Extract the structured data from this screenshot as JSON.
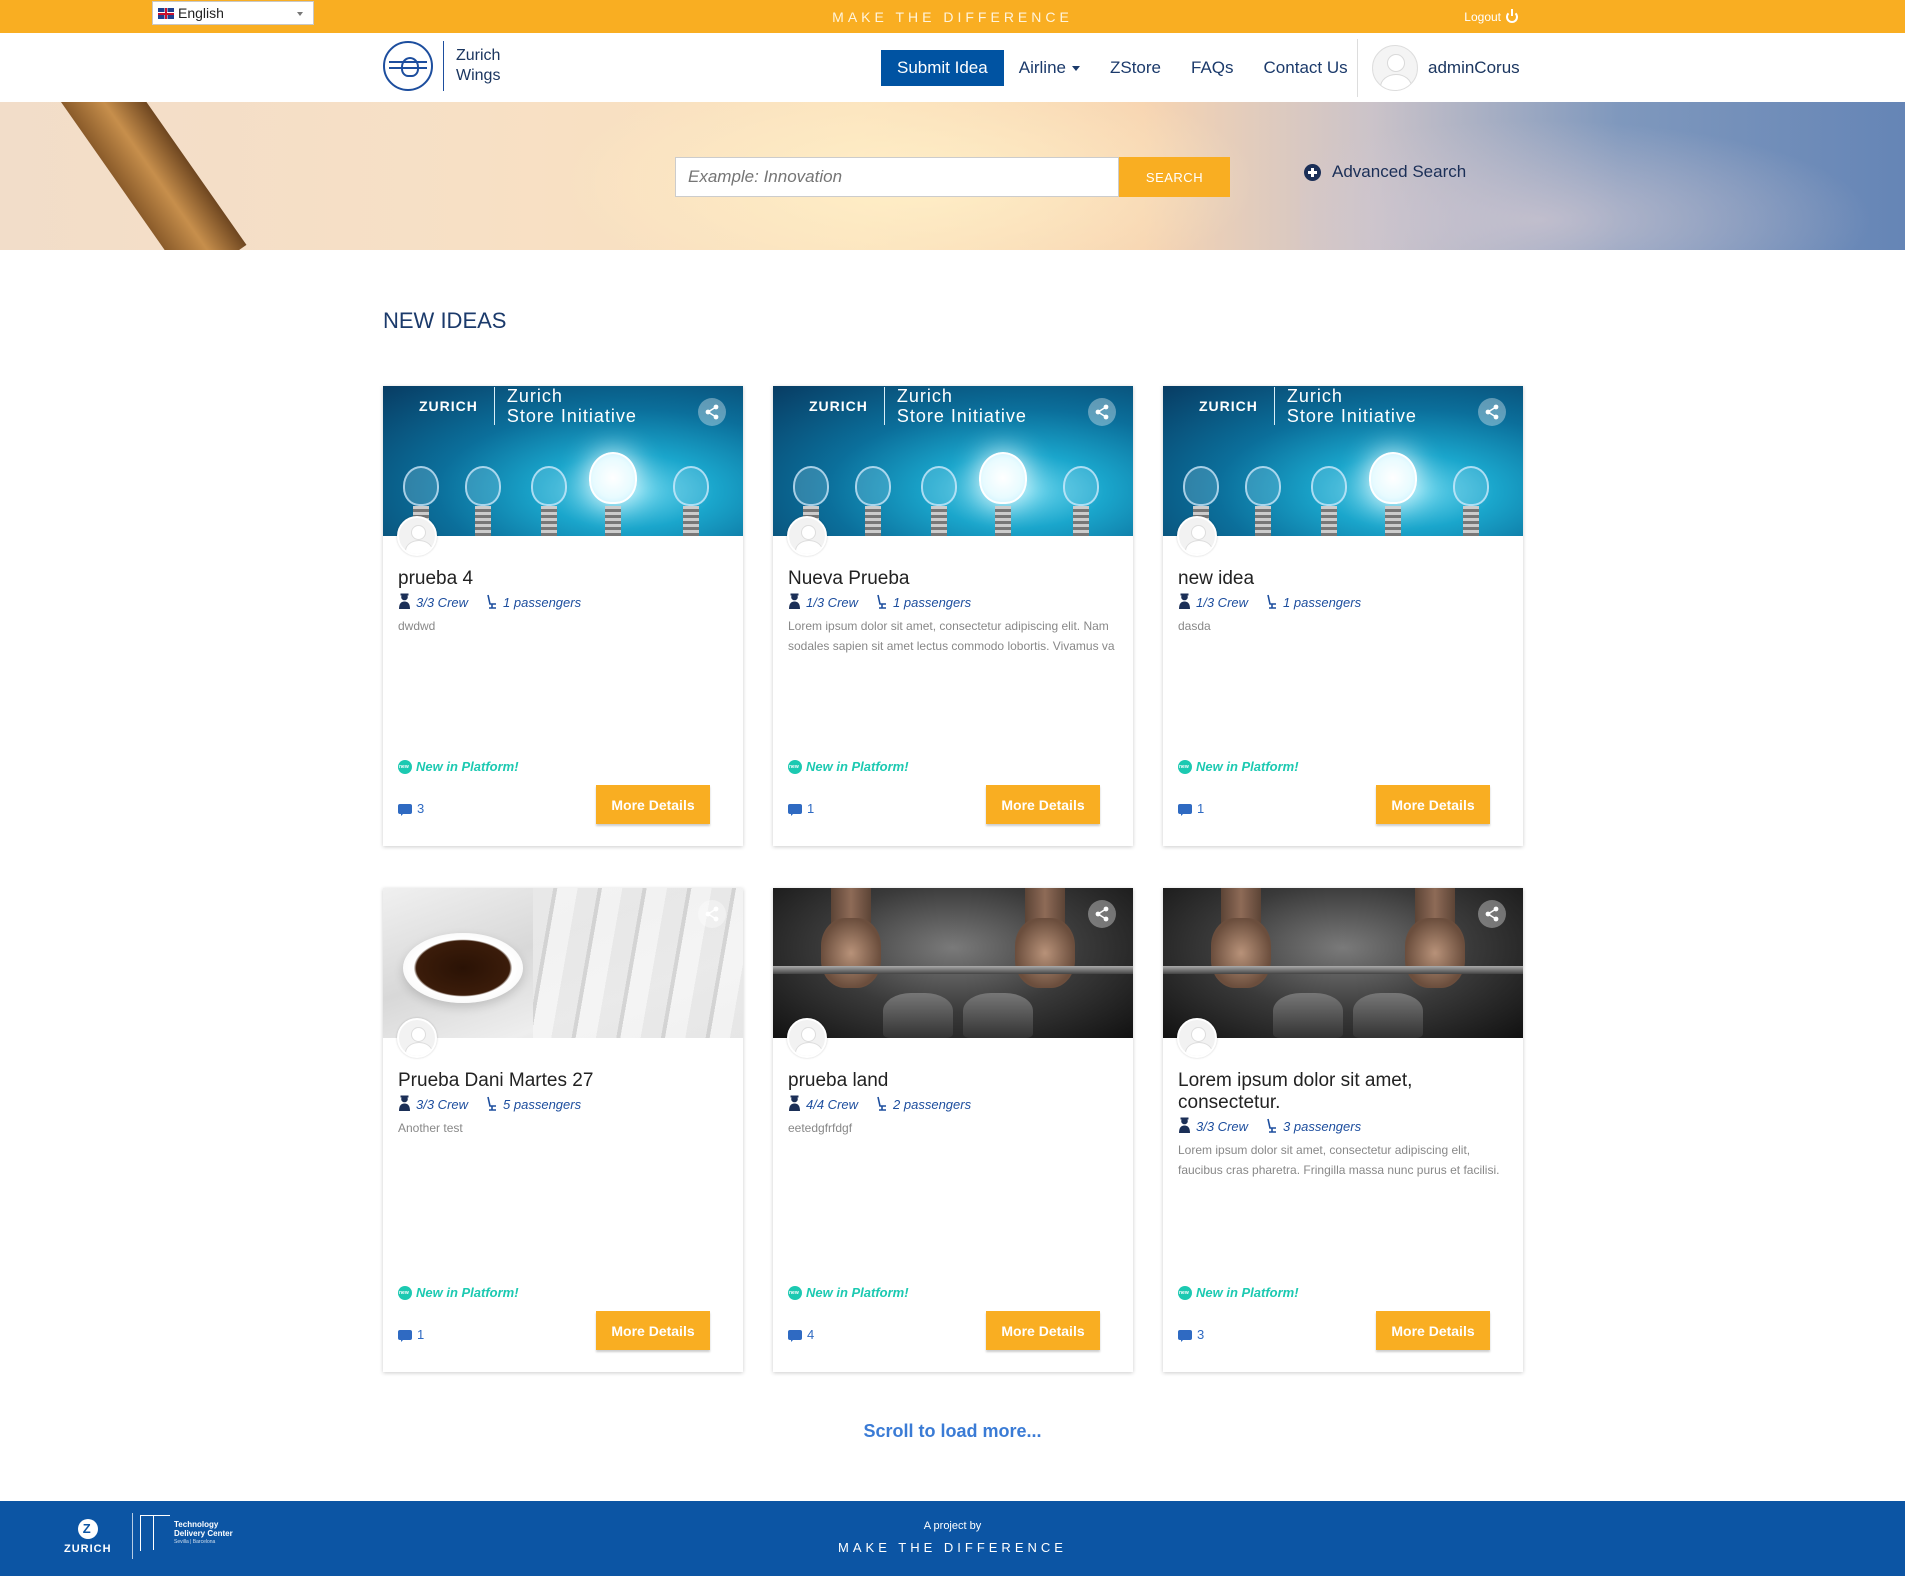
{
  "topbar": {
    "language": "English",
    "tagline": "MAKE THE DIFFERENCE",
    "logout": "Logout"
  },
  "brand": {
    "line1": "Zurich",
    "line2": "Wings"
  },
  "nav": {
    "submit_idea": "Submit Idea",
    "airline": "Airline",
    "zstore": "ZStore",
    "faqs": "FAQs",
    "contact": "Contact Us",
    "username": "adminCorus"
  },
  "search": {
    "placeholder": "Example: Innovation",
    "button": "SEARCH",
    "advanced": "Advanced Search"
  },
  "section_title": "NEW IDEAS",
  "card_banner": {
    "brand": "ZURICH",
    "line1": "Zurich",
    "line2": "Store Initiative"
  },
  "cards": [
    {
      "title": "prueba 4",
      "crew": "3/3 Crew",
      "passengers": "1 passengers",
      "description": "dwdwd",
      "badge": "New in Platform!",
      "comments": "3",
      "button": "More Details"
    },
    {
      "title": "Nueva Prueba",
      "crew": "1/3 Crew",
      "passengers": "1 passengers",
      "description": "Lorem ipsum dolor sit amet, consectetur adipiscing elit. Nam sodales sapien sit amet lectus commodo lobortis. Vivamus va",
      "badge": "New in Platform!",
      "comments": "1",
      "button": "More Details"
    },
    {
      "title": "new idea",
      "crew": "1/3 Crew",
      "passengers": "1 passengers",
      "description": "dasda",
      "badge": "New in Platform!",
      "comments": "1",
      "button": "More Details"
    },
    {
      "title": "Prueba Dani Martes 27",
      "crew": "3/3 Crew",
      "passengers": "5 passengers",
      "description": "Another test",
      "badge": "New in Platform!",
      "comments": "1",
      "button": "More Details"
    },
    {
      "title": "prueba land",
      "crew": "4/4 Crew",
      "passengers": "2 passengers",
      "description": "eetedgfrfdgf",
      "badge": "New in Platform!",
      "comments": "4",
      "button": "More Details"
    },
    {
      "title": "Lorem ipsum dolor sit amet, consectetur.",
      "crew": "3/3 Crew",
      "passengers": "3 passengers",
      "description": "Lorem ipsum dolor sit amet, consectetur adipiscing elit, faucibus cras pharetra. Fringilla massa nunc purus et facilisi.",
      "badge": "New in Platform!",
      "comments": "3",
      "button": "More Details"
    }
  ],
  "load_more": "Scroll to load more...",
  "footer": {
    "zurich": "ZURICH",
    "tdc_line1": "Technology",
    "tdc_line2": "Delivery Center",
    "tdc_sub": "Sevilla | Barcelona",
    "project": "A project by",
    "tagline": "MAKE THE DIFFERENCE"
  },
  "colors": {
    "accent": "#f9ae22",
    "primary": "#0053a2",
    "footer": "#0c55a4",
    "badge": "#1cc9b1"
  }
}
